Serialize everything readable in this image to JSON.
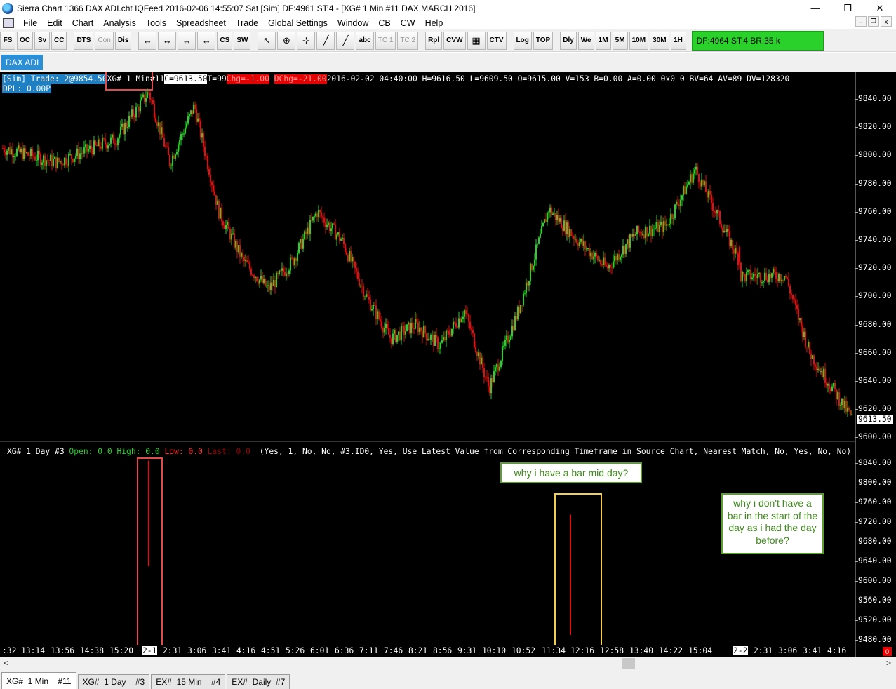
{
  "window": {
    "title": "Sierra Chart 1366 DAX ADI.cht  IQFeed 2016-02-06  14:55:07 Sat [Sim]  DF:4961  ST:4 - [XG#  1 Min  #11  DAX MARCH 2016]",
    "minimize": "—",
    "maximize": "❐",
    "close": "✕"
  },
  "menu": [
    "File",
    "Edit",
    "Chart",
    "Analysis",
    "Tools",
    "Spreadsheet",
    "Trade",
    "Global Settings",
    "Window",
    "CB",
    "CW",
    "Help"
  ],
  "mdi": {
    "minimize": "–",
    "restore": "❐",
    "close": "x"
  },
  "toolbar": {
    "group1": [
      "FS",
      "OC",
      "Sv",
      "CC"
    ],
    "group2": [
      "DTS",
      "Con",
      "Dis"
    ],
    "group3_icons": [
      "↔",
      "↔",
      "↔",
      "↔"
    ],
    "cs": "CS",
    "sw": "SW",
    "group4_icons": [
      "↖",
      "⊕",
      "⊹",
      "╱",
      "╱"
    ],
    "abc": "abc",
    "tc1": "TC 1",
    "tc2": "TC 2",
    "group5": [
      "Rpl",
      "CVW"
    ],
    "ttw": "▦",
    "ctv": "CTV",
    "group6": [
      "Log",
      "TOP"
    ],
    "group7": [
      "Dly",
      "We",
      "1M",
      "5M",
      "10M",
      "30M",
      "1H"
    ],
    "status": "DF:4964   ST:4   BR:35 k"
  },
  "chart_tab": "DAX ADI",
  "info_line": {
    "sim": "[Sim]  Trade: 2@9854.50 ",
    "symbol": "XG#  1 Min",
    "number": "  #11 ",
    "close": "C=9613.50",
    "t": " T=99 ",
    "chg": "Chg=-1.00",
    "dchg": "DChg=-21.00",
    "rest": " 2016-02-02 04:40:00 H=9616.50 L=9609.50 O=9615.00 V=153 B=0.00 A=0.00 0x0 0 BV=64 AV=89 DV=128320",
    "dpl": "DPL: 0.00P"
  },
  "study_line": {
    "name": "XG#  1 Day   #3 ",
    "open": "Open: 0.0",
    "high": "High: 0.0",
    "low": "Low: 0.0",
    "last": "Last: 0.0",
    "params": "(Yes, 1, No, No, #3.ID0, Yes, Use Latest Value from Corresponding Timeframe in Source Chart, Nearest Match, No, Yes, No, No)"
  },
  "price_axis_top": [
    "9840.00",
    "9820.00",
    "9800.00",
    "9780.00",
    "9760.00",
    "9740.00",
    "9720.00",
    "9700.00",
    "9680.00",
    "9660.00",
    "9640.00",
    "9620.00",
    "9600.00"
  ],
  "price_axis_bottom": [
    "9840.00",
    "9800.00",
    "9760.00",
    "9720.00",
    "9680.00",
    "9640.00",
    "9600.00",
    "9560.00",
    "9520.00",
    "9480.00"
  ],
  "last_price": "9613.50",
  "time_axis": [
    ":32",
    "13:14",
    "13:56",
    "14:38",
    "15:20",
    "2-1",
    "2:31",
    "3:06",
    "3:41",
    "4:16",
    "4:51",
    "5:26",
    "6:01",
    "6:36",
    "7:11",
    "7:46",
    "8:21",
    "8:56",
    "9:31",
    "10:10",
    "10:52",
    "11:34",
    "12:16",
    "12:58",
    "13:40",
    "14:22",
    "15:04",
    "2-2",
    "2:31",
    "3:06",
    "3:41",
    "4:16"
  ],
  "notes": {
    "mid_day": "why i have a bar mid day?",
    "start_day": "why i don't have a bar in the start of the day as i had the day before?"
  },
  "bottom_tabs": [
    "XG#  1 Min    #11",
    "XG#  1 Day    #3",
    "EX#  15 Min    #4",
    "EX#  Daily  #7"
  ],
  "scroll": {
    "left": "<",
    "right": ">"
  },
  "corner": "0",
  "colors": {
    "up": "#2bd12b",
    "down": "#e01010",
    "background": "#000000",
    "accent": "#1e7fc2"
  },
  "chart_data": [
    {
      "type": "candlestick",
      "title": "XG#  1 Min  #11",
      "ylim": [
        9596,
        9848
      ],
      "key_points": [
        {
          "t": ":32",
          "price": 9805
        },
        {
          "t": "13:56",
          "price": 9795
        },
        {
          "t": "15:20",
          "price": 9812
        },
        {
          "t": "2-1",
          "price": 9845
        },
        {
          "t": "2:31",
          "price": 9795
        },
        {
          "t": "3:06",
          "price": 9835
        },
        {
          "t": "3:41",
          "price": 9760
        },
        {
          "t": "4:16",
          "price": 9725
        },
        {
          "t": "4:51",
          "price": 9705
        },
        {
          "t": "5:26",
          "price": 9725
        },
        {
          "t": "6:01",
          "price": 9760
        },
        {
          "t": "6:36",
          "price": 9740
        },
        {
          "t": "7:11",
          "price": 9700
        },
        {
          "t": "7:46",
          "price": 9670
        },
        {
          "t": "8:21",
          "price": 9680
        },
        {
          "t": "8:56",
          "price": 9665
        },
        {
          "t": "9:31",
          "price": 9690
        },
        {
          "t": "10:10",
          "price": 9635
        },
        {
          "t": "10:52",
          "price": 9690
        },
        {
          "t": "11:34",
          "price": 9762
        },
        {
          "t": "12:16",
          "price": 9740
        },
        {
          "t": "12:58",
          "price": 9720
        },
        {
          "t": "13:40",
          "price": 9745
        },
        {
          "t": "14:22",
          "price": 9750
        },
        {
          "t": "15:04",
          "price": 9790
        },
        {
          "t": "2-2",
          "price": 9725
        },
        {
          "t": "2:31",
          "price": 9705
        },
        {
          "t": "3:06",
          "price": 9715
        },
        {
          "t": "3:41",
          "price": 9660
        },
        {
          "t": "4:16",
          "price": 9613.5
        }
      ]
    },
    {
      "type": "bar",
      "title": "XG#  1 Day   #3",
      "ylim": [
        9470,
        9852
      ],
      "bars": [
        {
          "t": "2-1",
          "high": 9845,
          "low": 9630
        },
        {
          "t": "12:16",
          "high": 9735,
          "low": 9490
        }
      ]
    }
  ]
}
